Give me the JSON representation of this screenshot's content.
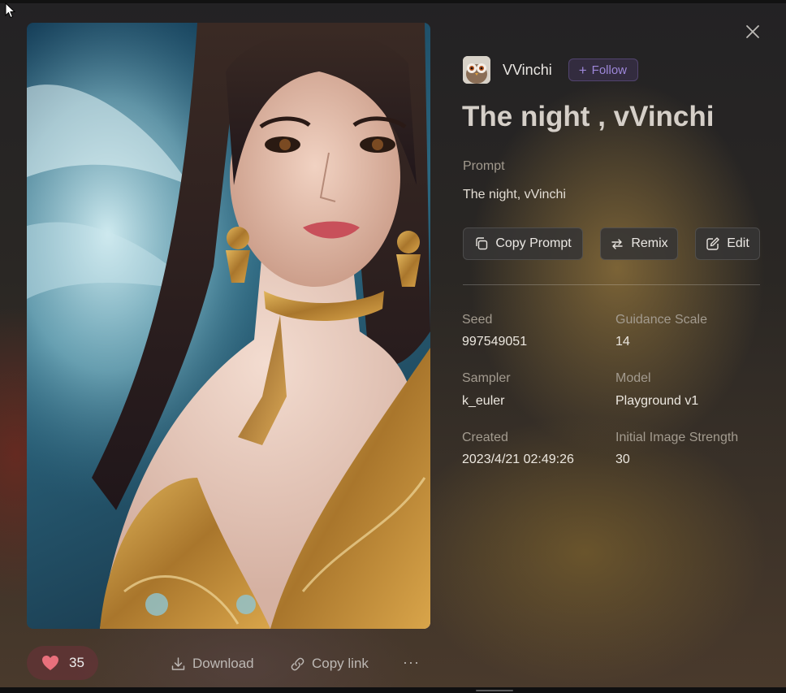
{
  "author": {
    "name": "VVinchi",
    "follow_label": "Follow"
  },
  "title": "The night , vVinchi",
  "prompt": {
    "label": "Prompt",
    "text": "The night, vVinchi"
  },
  "actions": {
    "copy_prompt": "Copy Prompt",
    "remix": "Remix",
    "edit": "Edit"
  },
  "meta": {
    "seed_label": "Seed",
    "seed": "997549051",
    "guidance_label": "Guidance Scale",
    "guidance": "14",
    "sampler_label": "Sampler",
    "sampler": "k_euler",
    "model_label": "Model",
    "model": "Playground v1",
    "created_label": "Created",
    "created": "2023/4/21 02:49:26",
    "strength_label": "Initial Image Strength",
    "strength": "30"
  },
  "footer": {
    "likes": "35",
    "download_label": "Download",
    "copy_link_label": "Copy link",
    "more_label": "···"
  },
  "colors": {
    "accent": "#9d86d8",
    "like": "#e8707c",
    "panel_button": "#363434"
  },
  "icons": [
    "close-icon",
    "plus-icon",
    "copy-icon",
    "remix-icon",
    "edit-icon",
    "heart-icon",
    "download-icon",
    "link-icon",
    "more-icon",
    "cursor-icon"
  ]
}
